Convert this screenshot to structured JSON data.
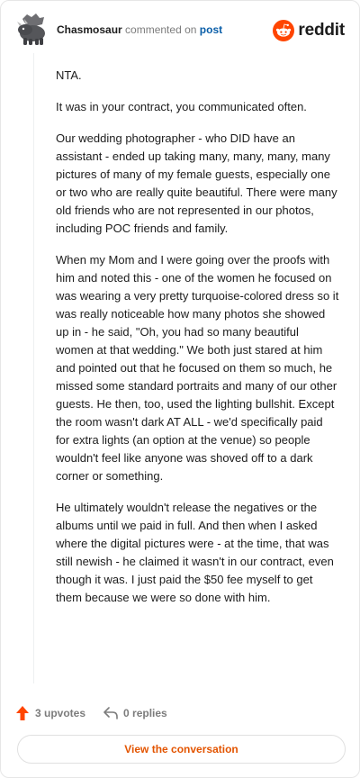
{
  "header": {
    "username": "Chasmosaur",
    "action_text": "commented on",
    "post_link": "post",
    "logo_text": "reddit"
  },
  "comment": {
    "paragraphs": [
      "NTA.",
      "It was in your contract, you communicated often.",
      "Our wedding photographer - who DID have an assistant - ended up taking many, many, many, many pictures of many of my female guests, especially one or two who are really quite beautiful. There were many old friends who are not represented in our photos, including POC friends and family.",
      "When my Mom and I were going over the proofs with him and noted this - one of the women he focused on was wearing a very pretty turquoise-colored dress so it was really noticeable how many photos she showed up in - he said, \"Oh, you had so many beautiful women at that wedding.\" We both just stared at him and pointed out that he focused on them so much, he missed some standard portraits and many of our other guests. He then, too, used the lighting bullshit. Except the room wasn't dark AT ALL - we'd specifically paid for extra lights (an option at the venue) so people wouldn't feel like anyone was shoved off to a dark corner or something.",
      "He ultimately wouldn't release the negatives or the albums until we paid in full. And then when I asked where the digital pictures were - at the time, that was still newish - he claimed it wasn't in our contract, even though it was. I just paid the $50 fee myself to get them because we were so done with him."
    ]
  },
  "footer": {
    "upvotes": "3 upvotes",
    "replies": "0 replies",
    "cta": "View the conversation"
  },
  "colors": {
    "brand": "#ff4500",
    "link": "#0a5ea8",
    "cta_text": "#e35400",
    "muted": "#7c7c7c"
  },
  "icons": {
    "avatar": "dinosaur-avatar",
    "logo": "reddit-snoo-icon",
    "upvote": "upvote-arrow-icon",
    "reply": "reply-arrow-icon"
  }
}
